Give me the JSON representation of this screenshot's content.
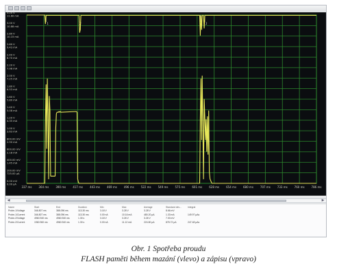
{
  "chart_data": {
    "type": "line",
    "title": "",
    "x_tick_labels": [
      "337 ms",
      "364 ms",
      "390 ms",
      "417 ms",
      "443 ms",
      "469 ms",
      "496 ms",
      "522 ms",
      "549 ms",
      "575 ms",
      "601 ms",
      "628 ms",
      "654 ms",
      "680 ms",
      "707 ms",
      "733 ms",
      "760 ms",
      "786 ms"
    ],
    "xlim": [
      337,
      786
    ],
    "left_tick_labels": [
      [
        "3.20 V",
        "11.60 mA"
      ],
      [
        "3.00 V",
        "10.88 mA"
      ],
      [
        "2.80 V",
        "10.15 mA"
      ],
      [
        "2.60 V",
        "9.43 mA"
      ],
      [
        "2.40 V",
        "8.70 mA"
      ],
      [
        "2.20 V",
        "7.98 mA"
      ],
      [
        "2.00 V",
        "7.25 mA"
      ],
      [
        "1.80 V",
        "6.53 mA"
      ],
      [
        "1.60 V",
        "5.80 mA"
      ],
      [
        "1.40 V",
        "5.08 mA"
      ],
      [
        "1.20 V",
        "4.35 mA"
      ],
      [
        "1.00 V",
        "3.63 mA"
      ],
      [
        "800.00 mV",
        "2.90 mA"
      ],
      [
        "600.00 mV",
        "2.18 mA"
      ],
      [
        "400.00 mV",
        "1.45 mA"
      ],
      [
        "200.00 mV",
        "725.00 µA"
      ],
      [
        "0.00 mV",
        "0.00 µA"
      ]
    ],
    "ylim_current_mA": [
      0,
      11.6
    ],
    "series": [
      {
        "x": [
          337,
          365,
          366,
          367,
          368,
          369,
          370,
          371,
          372,
          373,
          374,
          381,
          382,
          383,
          384,
          385,
          386,
          387,
          388,
          389,
          390,
          414,
          415,
          416,
          417,
          418,
          448,
          605,
          606,
          607,
          608,
          609,
          610,
          611,
          612,
          613,
          614,
          615,
          616,
          617,
          618,
          619,
          620,
          621,
          622,
          623,
          624,
          650,
          786
        ],
        "y": [
          0.0,
          0.0,
          4.2,
          6.8,
          2.4,
          7.2,
          4.8,
          0.3,
          6.0,
          5.0,
          0.5,
          0.5,
          3.8,
          4.8,
          4.9,
          4.9,
          4.9,
          4.95,
          4.9,
          4.95,
          4.9,
          4.95,
          4.9,
          0.3,
          0.1,
          0.0,
          0.0,
          0.0,
          4.4,
          7.2,
          3.0,
          7.4,
          3.8,
          0.3,
          5.8,
          4.6,
          3.0,
          4.4,
          2.2,
          4.6,
          2.0,
          5.0,
          0.8,
          0.3,
          0.2,
          0.1,
          0.0,
          0.0,
          0.0
        ]
      },
      {
        "x": [
          337,
          365,
          366,
          367,
          418,
          419,
          420,
          421,
          422,
          605,
          606,
          607,
          608,
          609,
          611,
          612,
          613,
          614,
          786
        ],
        "y": [
          11.6,
          11.6,
          11.0,
          11.58,
          11.58,
          10.4,
          10.6,
          11.58,
          11.58,
          11.58,
          10.2,
          11.58,
          10.6,
          11.58,
          11.58,
          10.7,
          11.58,
          11.58,
          11.58
        ]
      }
    ],
    "colors": {
      "trace": "#e8e85a",
      "grid": "#2d8a2d",
      "background": "#0b0d10",
      "axis_text": "#d8d8c8"
    }
  },
  "marker_labels": [
    "1",
    "2",
    "1",
    "2"
  ],
  "measurement_table": {
    "headers": [
      "Name",
      "Start",
      "End",
      "Duration",
      "Min",
      "Max",
      "Average",
      "Standard dev...",
      "Integral"
    ],
    "rows": [
      [
        "Probe-1/Voltage",
        "346.807 ms",
        "388.096 ms",
        "113.30 ms",
        "3.18 V",
        "3.28 V",
        "3.28 V",
        "8.66 mV",
        ""
      ],
      [
        "Probe-1/Current",
        "346.807 ms",
        "388.096 ms",
        "113.30 ms",
        "0.00 nA",
        "10.16 mA",
        "480.20 µA",
        "1.33 mA",
        "149.97 µAs"
      ],
      [
        "Probe-2/Voltage",
        "4960.940 ms",
        "4960.940 ms",
        "1.30 s",
        "3.18 V",
        "3.26 V",
        "3.26 V",
        "7.00 mV",
        ""
      ],
      [
        "Probe-2/Current",
        "1960.960 ms",
        "4960.940 ms",
        "1.30 s",
        "0.00 nA",
        "11.12 mA",
        "224.80 µA",
        "878.72 µA",
        "247.48 µAs"
      ]
    ]
  },
  "caption": {
    "line1": "Obr. 1  Spotřeba proudu",
    "line2": "FLASH paměti během mazání (vlevo) a zápisu (vpravo)"
  }
}
